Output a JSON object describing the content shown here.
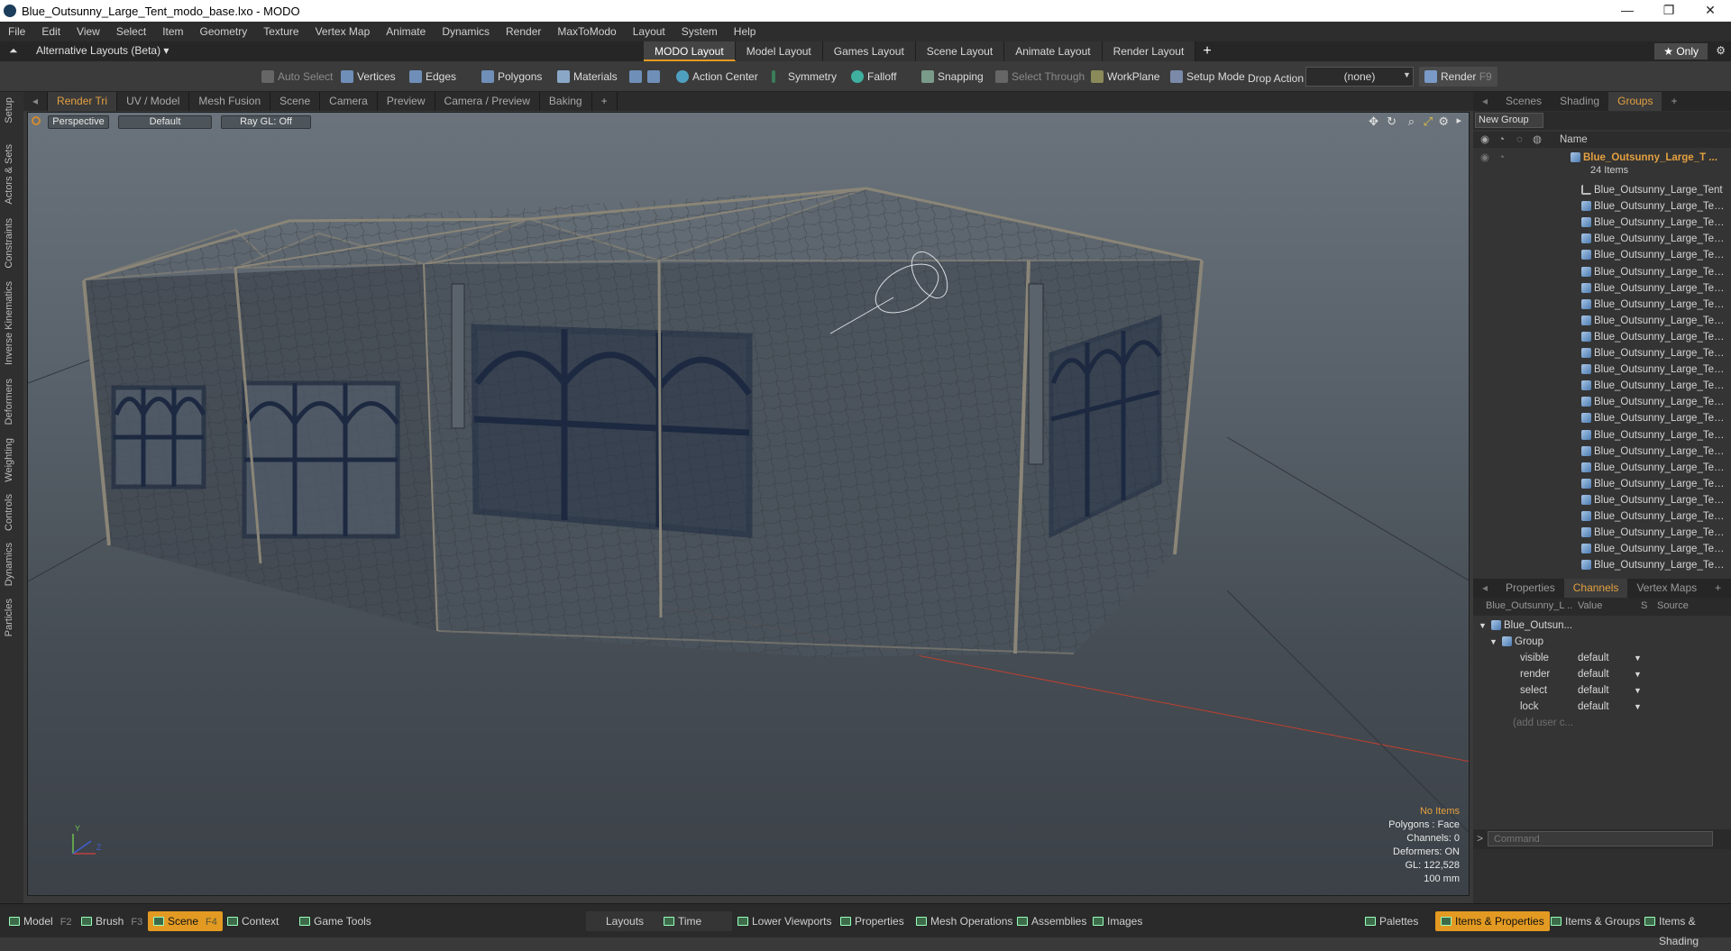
{
  "window": {
    "title": "Blue_Outsunny_Large_Tent_modo_base.lxo - MODO",
    "controls": [
      "—",
      "❐",
      "✕"
    ]
  },
  "menu": [
    "File",
    "Edit",
    "View",
    "Select",
    "Item",
    "Geometry",
    "Texture",
    "Vertex Map",
    "Animate",
    "Dynamics",
    "Render",
    "MaxToModo",
    "Layout",
    "System",
    "Help"
  ],
  "layouts": {
    "alternative": "Alternative Layouts (Beta) ▾",
    "tabs": [
      "MODO Layout",
      "Model Layout",
      "Games Layout",
      "Scene Layout",
      "Animate Layout",
      "Render Layout"
    ],
    "only": "★ Only"
  },
  "toolbar": {
    "auto_select": "Auto Select",
    "vertices": "Vertices",
    "edges": "Edges",
    "polygons": "Polygons",
    "materials": "Materials",
    "action_center": "Action Center",
    "symmetry": "Symmetry",
    "falloff": "Falloff",
    "snapping": "Snapping",
    "select_through": "Select Through",
    "workplane": "WorkPlane",
    "setup_mode": "Setup Mode",
    "drop_action_label": "Drop Action",
    "drop_action_value": "(none)",
    "render": "Render",
    "render_key": "F9"
  },
  "left_tabs": [
    "Setup",
    "Actors & Sets",
    "Constraints",
    "Inverse Kinematics",
    "Deformers",
    "Weighting",
    "Controls",
    "Dynamics",
    "Particles"
  ],
  "viewport_tabs": [
    "Render Tri",
    "UV / Model",
    "Mesh Fusion",
    "Scene",
    "Camera",
    "Preview",
    "Camera / Preview",
    "Baking",
    "+"
  ],
  "viewport": {
    "view": "Perspective",
    "shading": "Default",
    "raygl": "Ray GL: Off",
    "info": {
      "no_items": "No Items",
      "polygons": "Polygons : Face",
      "channels": "Channels: 0",
      "deformers": "Deformers: ON",
      "gl": "GL: 122,528",
      "scale": "100 mm"
    }
  },
  "right_top_tabs": [
    "Scenes",
    "Shading",
    "Groups",
    "+"
  ],
  "groups": {
    "new_group": "New Group",
    "name_header": "Name",
    "group_name": "Blue_Outsunny_Large_T ...",
    "count": "24 Items",
    "items": [
      "Blue_Outsunny_Large_Tent",
      "Blue_Outsunny_Large_Ten ...",
      "Blue_Outsunny_Large_Ten ...",
      "Blue_Outsunny_Large_Ten ...",
      "Blue_Outsunny_Large_Ten ...",
      "Blue_Outsunny_Large_Ten ...",
      "Blue_Outsunny_Large_Ten ...",
      "Blue_Outsunny_Large_Ten ...",
      "Blue_Outsunny_Large_Ten ...",
      "Blue_Outsunny_Large_Ten ...",
      "Blue_Outsunny_Large_Ten ...",
      "Blue_Outsunny_Large_Ten ...",
      "Blue_Outsunny_Large_Ten ...",
      "Blue_Outsunny_Large_Ten ...",
      "Blue_Outsunny_Large_Ten ...",
      "Blue_Outsunny_Large_Ten ...",
      "Blue_Outsunny_Large_Ten ...",
      "Blue_Outsunny_Large_Ten ...",
      "Blue_Outsunny_Large_Ten ...",
      "Blue_Outsunny_Large_Ten ...",
      "Blue_Outsunny_Large_Ten ...",
      "Blue_Outsunny_Large_Ten ...",
      "Blue_Outsunny_Large_Ten ...",
      "Blue_Outsunny_Large_Ten ..."
    ]
  },
  "right_bottom_tabs": [
    "Properties",
    "Channels",
    "Vertex Maps",
    "+"
  ],
  "channels": {
    "col_item": "Blue_Outsunny_L ...",
    "col_value": "Value",
    "col_s": "S",
    "col_source": "Source",
    "root": "Blue_Outsun...",
    "group": "Group",
    "rows": [
      {
        "name": "visible",
        "value": "default"
      },
      {
        "name": "render",
        "value": "default"
      },
      {
        "name": "select",
        "value": "default"
      },
      {
        "name": "lock",
        "value": "default"
      }
    ],
    "add_user": "(add user c...",
    "command_placeholder": "Command"
  },
  "bottom_bar": {
    "left": [
      {
        "label": "Model",
        "key": "F2"
      },
      {
        "label": "Brush",
        "key": "F3"
      },
      {
        "label": "Scene",
        "key": "F4"
      },
      {
        "label": "Context",
        "key": ""
      },
      {
        "label": "Game Tools",
        "key": ""
      }
    ],
    "center": [
      "Layouts",
      "Time",
      "Lower Viewports",
      "Properties",
      "Mesh Operations",
      "Assemblies",
      "Images"
    ],
    "right": [
      "Palettes",
      "Items & Properties",
      "Items & Groups",
      "Items & Shading"
    ]
  },
  "colors": {
    "accent": "#e39a22",
    "mesh_blue": "#1c2940",
    "wire": "#8a8577"
  }
}
